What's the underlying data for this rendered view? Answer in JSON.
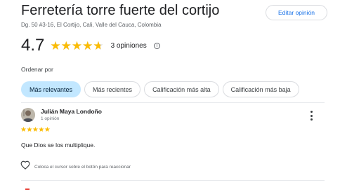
{
  "place": {
    "name": "Ferretería torre fuerte del cortijo",
    "address": "Dg. 50 #3-16, El Cortijo, Cali, Valle del Cauca, Colombia"
  },
  "edit_review_label": "Editar opinión",
  "rating": {
    "value": "4.7",
    "stars_fraction": 0.94,
    "count_label": "3 opiniones",
    "info_icon": "info-icon"
  },
  "sort": {
    "label": "Ordenar por",
    "options": [
      {
        "label": "Más relevantes",
        "selected": true
      },
      {
        "label": "Más recientes",
        "selected": false
      },
      {
        "label": "Calificación más alta",
        "selected": false
      },
      {
        "label": "Calificación más baja",
        "selected": false
      }
    ]
  },
  "reviews": [
    {
      "author": "Julián Maya Londoño",
      "meta": "1 opinión",
      "stars": 5,
      "stars_text": "★★★★★",
      "text": "Que Dios se los multiplique.",
      "react_hint": "Coloca el cursor sobre el botón para reaccionar",
      "more_icon": "more-vert-icon",
      "react_icon": "heart-outline-icon"
    }
  ],
  "colors": {
    "star": "#fbbc04",
    "accent_blue": "#1a73e8",
    "chip_active_bg": "#c2e7ff"
  }
}
